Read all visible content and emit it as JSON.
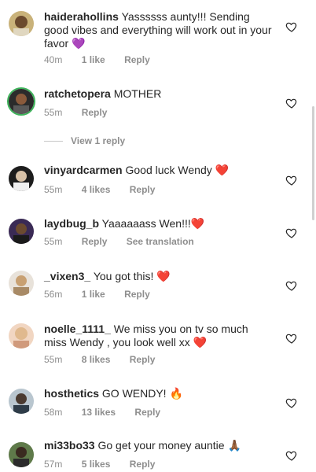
{
  "comments": [
    {
      "username": "haiderahollins",
      "text": "Yassssss aunty!!! Sending good vibes and everything will work out in your favor",
      "emoji": "💜",
      "time": "40m",
      "likes": "1 like",
      "reply": "Reply",
      "extra": ""
    },
    {
      "username": "ratchetopera",
      "text": "MOTHER",
      "emoji": "",
      "time": "55m",
      "likes": "",
      "reply": "Reply",
      "extra": ""
    },
    {
      "username": "vinyardcarmen",
      "text": "Good luck Wendy",
      "emoji": "❤️",
      "time": "55m",
      "likes": "4 likes",
      "reply": "Reply",
      "extra": ""
    },
    {
      "username": "laydbug_b",
      "text": "Yaaaaaass Wen!!!",
      "emoji": "❤️",
      "time": "55m",
      "likes": "",
      "reply": "Reply",
      "extra": "See translation"
    },
    {
      "username": "_vixen3_",
      "text": "You got this!",
      "emoji": "❤️",
      "time": "56m",
      "likes": "1 like",
      "reply": "Reply",
      "extra": ""
    },
    {
      "username": "noelle_1111_",
      "text": "We miss you on tv so much miss Wendy , you look well xx",
      "emoji": "❤️",
      "time": "55m",
      "likes": "8 likes",
      "reply": "Reply",
      "extra": ""
    },
    {
      "username": "hosthetics",
      "text": "GO WENDY!",
      "emoji": "🔥",
      "time": "58m",
      "likes": "13 likes",
      "reply": "Reply",
      "extra": ""
    },
    {
      "username": "mi33bo33",
      "text": "Go get your money auntie",
      "emoji": "🙏🏾",
      "time": "57m",
      "likes": "5 likes",
      "reply": "Reply",
      "extra": ""
    }
  ],
  "view_replies": "View 1 reply",
  "icons": {
    "like": "heart-outline-icon"
  },
  "colors": {
    "text": "#262626",
    "meta": "#8e8e8e",
    "story_ring": "#3db35a"
  }
}
